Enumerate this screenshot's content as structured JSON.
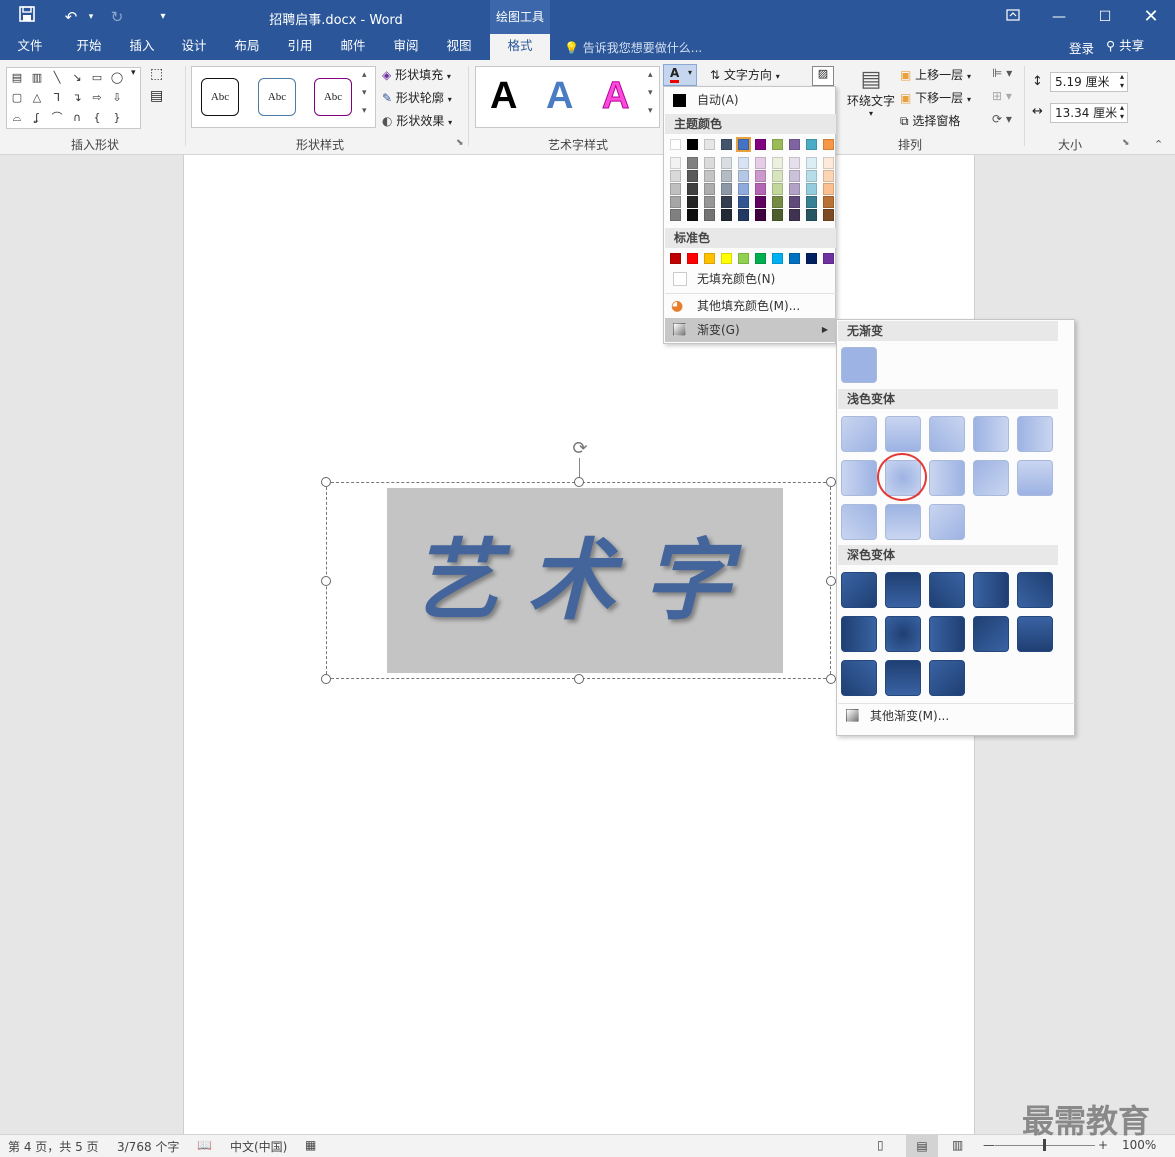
{
  "titlebar": {
    "document_title": "招聘启事.docx - Word",
    "context_label": "绘图工具",
    "icons": [
      "save-icon",
      "undo-icon",
      "redo-icon",
      "customize-icon",
      "ribbon-display-icon",
      "minimize-icon",
      "maximize-icon",
      "close-icon"
    ]
  },
  "tabs": [
    "文件",
    "开始",
    "插入",
    "设计",
    "布局",
    "引用",
    "邮件",
    "审阅",
    "视图",
    "格式"
  ],
  "active_tab": "格式",
  "tell_me": "告诉我您想要做什么...",
  "signin": "登录",
  "share": "共享",
  "ribbon": {
    "insert_shapes_label": "插入形状",
    "shape_styles_label": "形状样式",
    "shape_style_sample": "Abc",
    "shape_fill": "形状填充",
    "shape_outline": "形状轮廓",
    "shape_effects": "形状效果",
    "wordart_styles_label": "艺术字样式",
    "wordart_letter": "A",
    "text_direction": "文字方向",
    "wrap_text": "环绕文字",
    "bring_forward": "上移一层",
    "send_backward": "下移一层",
    "selection_pane": "选择窗格",
    "arrange_label": "排列",
    "height_value": "5.19 厘米",
    "width_value": "13.34 厘米",
    "size_label": "大小"
  },
  "document": {
    "wordart_text": "艺术字"
  },
  "color_menu": {
    "auto": "自动(A)",
    "theme_colors_header": "主题颜色",
    "standard_colors_header": "标准色",
    "no_fill": "无填充颜色(N)",
    "more_colors": "其他填充颜色(M)...",
    "gradient": "渐变(G)",
    "theme_colors": [
      "#ffffff",
      "#000000",
      "#e7e6e6",
      "#44546a",
      "#4472c4",
      "#800080",
      "#9bbb59",
      "#8064a2",
      "#4bacc6",
      "#f79646"
    ],
    "standard_colors": [
      "#c00000",
      "#ff0000",
      "#ffc000",
      "#ffff00",
      "#92d050",
      "#00b050",
      "#00b0f0",
      "#0070c0",
      "#002060",
      "#7030a0"
    ]
  },
  "gradient_menu": {
    "no_gradient_header": "无渐变",
    "light_variations_header": "浅色变体",
    "dark_variations_header": "深色变体",
    "more_gradients": "其他渐变(M)...",
    "base_color": "#9db3e3",
    "light_color": "#c9d5f0",
    "dark_color": "#3a63a3",
    "dark_deep": "#1f3f73"
  },
  "status": {
    "page": "第 4 页，共 5 页",
    "words": "3/768 个字",
    "language": "中文(中国)",
    "zoom": "100%"
  },
  "watermark": "最需教育"
}
